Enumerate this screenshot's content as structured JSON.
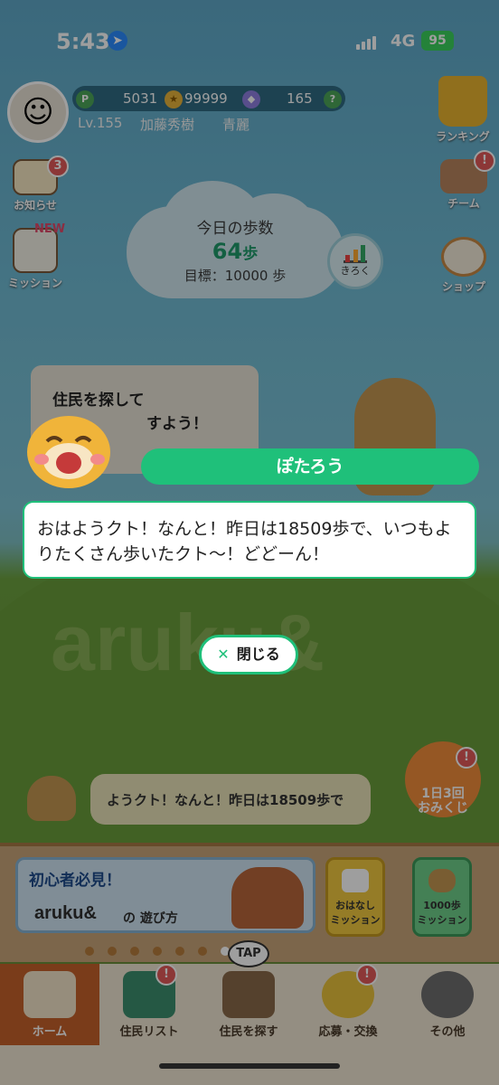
{
  "status_bar": {
    "time": "5:43",
    "network": "4G",
    "battery": "95"
  },
  "profile": {
    "points": "5031",
    "stars": "99999",
    "gems": "165",
    "level": "Lv.155",
    "name": "加藤秀樹",
    "team": "青麗",
    "help": "?"
  },
  "left_menu": {
    "notice_label": "お知らせ",
    "notice_badge": "3",
    "mission_label": "ミッション",
    "mission_new": "NEW"
  },
  "right_menu": {
    "ranking_label": "ランキング",
    "team_label": "チーム",
    "team_badge": "!",
    "shop_label": "ショップ"
  },
  "steps": {
    "title": "今日の歩数",
    "count": "64",
    "unit": "歩",
    "goal": "目標：10000 歩",
    "record_label": "きろく"
  },
  "background_speech": {
    "line1": "住民を探して",
    "line2": "すよう！"
  },
  "marquee_text": "ようクト！なんと！昨日は18509歩で",
  "omikuji": {
    "line1": "1日3回",
    "line2": "おみくじ",
    "badge": "!"
  },
  "banner": {
    "title": "初心者必見！",
    "logo": "aruku&",
    "subtitle": "の 遊び方"
  },
  "mission_cards": [
    {
      "label": "おはなし\nミッション"
    },
    {
      "label": "1000歩\nミッション"
    }
  ],
  "tabs": [
    {
      "label": "ホーム"
    },
    {
      "label": "住民リスト",
      "badge": "!"
    },
    {
      "label": "住民を探す",
      "tap": "TAP"
    },
    {
      "label": "応募・交換",
      "badge": "!"
    },
    {
      "label": "その他"
    }
  ],
  "dialog": {
    "speaker": "ぽたろう",
    "message": "おはようクト！なんと！昨日は18509歩で、いつもよりたくさん歩いたクト〜！どどーん！",
    "close_label": "閉じる"
  },
  "colors": {
    "accent": "#1fc07a",
    "home_tab": "#c6612a"
  }
}
